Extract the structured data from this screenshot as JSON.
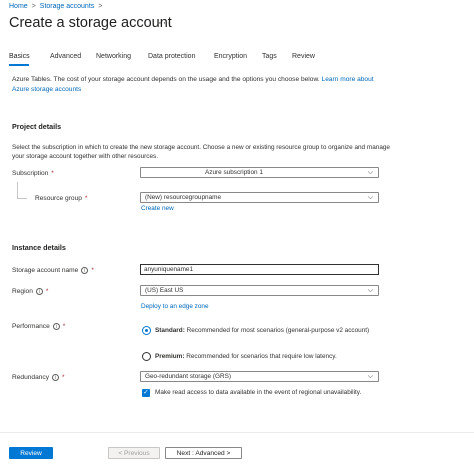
{
  "breadcrumb": {
    "home": "Home",
    "sep": ">",
    "storage": "Storage accounts",
    "sep2": ">"
  },
  "page": {
    "title": "Create a storage account",
    "more": "···"
  },
  "tabs": [
    "Basics",
    "Advanced",
    "Networking",
    "Data protection",
    "Encryption",
    "Tags",
    "Review"
  ],
  "info": {
    "text": "Azure Tables. The cost of your storage account depends on the usage and the options you choose below.",
    "link": "Learn more about Azure storage accounts"
  },
  "project": {
    "heading": "Project details",
    "description": "Select the subscription in which to create the new storage account. Choose a new or existing resource group to organize and manage your storage account together with other resources.",
    "subscription_label": "Subscription",
    "subscription_value": "Azure subscription 1",
    "rg_label": "Resource group",
    "rg_value": "(New) resourcegroupname",
    "create_new": "Create new"
  },
  "instance": {
    "heading": "Instance details",
    "name_label": "Storage account name",
    "name_value": "anyuniquename1",
    "region_label": "Region",
    "region_value": "(US) East US",
    "edge_link": "Deploy to an edge zone",
    "performance_label": "Performance",
    "standard_bold": "Standard:",
    "standard_text": "Recommended for most scenarios (general-purpose v2 account)",
    "premium_bold": "Premium:",
    "premium_text": "Recommended for scenarios that require low latency.",
    "redundancy_label": "Redundancy",
    "redundancy_value": "Geo-redundant storage (GRS)",
    "read_access_label": "Make read access to data available in the event of regional unavailability."
  },
  "required_mark": "*",
  "info_icon": "i",
  "chevron": "⌵",
  "footer": {
    "review": "Review",
    "previous": "< Previous",
    "next": "Next : Advanced >"
  },
  "colors": {
    "accent": "#0078d4",
    "link": "#0067b8"
  }
}
